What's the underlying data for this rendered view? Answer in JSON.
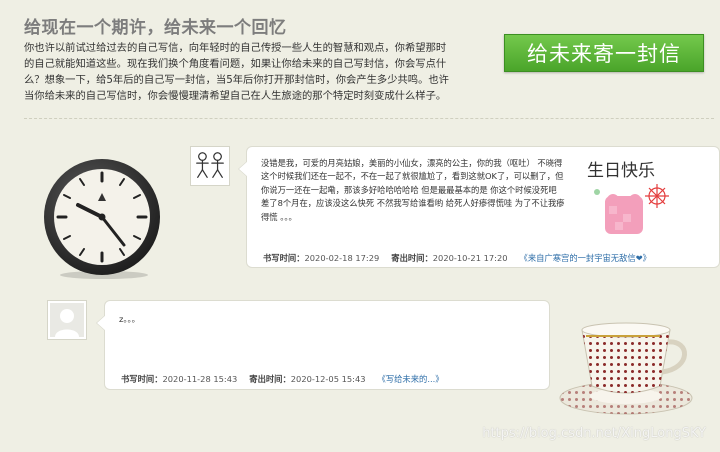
{
  "header": {
    "title": "给现在一个期许，给未来一个回忆",
    "intro": "你也许以前试过给过去的自己写信，向年轻时的自己传授一些人生的智慧和观点，你希望那时的自己就能知道这些。现在我们换个角度看问题，如果让你给未来的自己写封信，你会写点什么？想象一下，给5年后的自己写一封信，当5年后你打开那封信时，你会产生多少共鸣。也许当你给未来的自己写信时，你会慢慢理清希望自己在人生旅途的那个特定时刻变成什么样子。",
    "send_button": "给未来寄一封信"
  },
  "letters": [
    {
      "text": "没错是我，可爱的月亮姑娘，美丽的小仙女，漂亮的公主，你的我（呕吐） 不晓得这个时候我们还在一起不，不在一起了就很尴尬了，看到这就OK了，可以删了，但你说万一还在一起嘞，那该多好哈哈哈哈哈 但是最最基本的是 你这个时候没死吧 差了8个月在，应该没这么快死 不然我写给谁看哟 给死人好瘆得慌哇 为了不让我瘆得慌 。。。",
      "image_caption": "生日快乐",
      "write_label": "书写时间：",
      "write_time": "2020-02-18 17:29",
      "send_label": "寄出时间：",
      "send_time": "2020-10-21 17:20",
      "link_text": "《来自广寒宫的一封宇宙无敌信❤》"
    },
    {
      "text": "z。。。",
      "write_label": "书写时间：",
      "write_time": "2020-11-28 15:43",
      "send_label": "寄出时间：",
      "send_time": "2020-12-05 15:43",
      "link_text": "《写给未来的...》"
    }
  ],
  "watermark": "https://blog.csdn.net/XingLongSKY",
  "colors": {
    "button_green": "#4aa52a",
    "link_blue": "#2e6ea8",
    "background": "#efefe4"
  }
}
